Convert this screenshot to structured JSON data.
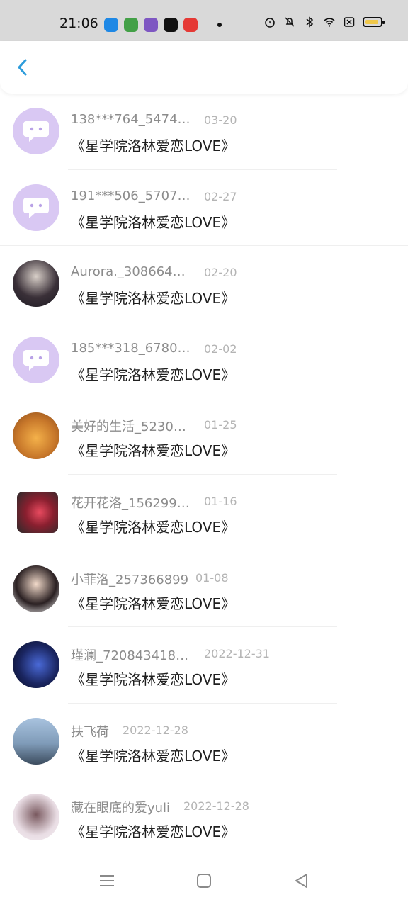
{
  "status_bar": {
    "time": "21:06",
    "app_icons": [
      {
        "name": "app-icon-1",
        "color": "#1e88e5"
      },
      {
        "name": "app-icon-2",
        "color": "#43a047"
      },
      {
        "name": "app-icon-3",
        "color": "#7e57c2"
      },
      {
        "name": "tiktok-icon",
        "color": "#111111"
      },
      {
        "name": "app-icon-5",
        "color": "#e53935"
      }
    ],
    "right_icons": [
      "alarm-icon",
      "mute-icon",
      "bluetooth-icon",
      "wifi-icon",
      "sim-icon",
      "battery-icon"
    ]
  },
  "header": {
    "back_icon": "chevron-left-icon",
    "accent": "#2d9cdb"
  },
  "messages": [
    {
      "name": "138***764_54743…",
      "date": "03-20",
      "content": "《星学院洛林爱恋LOVE》",
      "avatar": "default"
    },
    {
      "name": "191***506_570702…",
      "date": "02-27",
      "content": "《星学院洛林爱恋LOVE》",
      "avatar": "default"
    },
    {
      "name": "Aurora._30866421…",
      "date": "02-20",
      "content": "《星学院洛林爱恋LOVE》",
      "avatar": "photo"
    },
    {
      "name": "185***318_67801…",
      "date": "02-02",
      "content": "《星学院洛林爱恋LOVE》",
      "avatar": "default"
    },
    {
      "name": "美好的生活_52305…",
      "date": "01-25",
      "content": "《星学院洛林爱恋LOVE》",
      "avatar": "photo"
    },
    {
      "name": "花开花洛_156299…",
      "date": "01-16",
      "content": "《星学院洛林爱恋LOVE》",
      "avatar": "photo"
    },
    {
      "name": "小菲洛_257366899",
      "date": "01-08",
      "content": "《星学院洛林爱恋LOVE》",
      "avatar": "photo"
    },
    {
      "name": "瑾澜_7208434186…",
      "date": "2022-12-31",
      "content": "《星学院洛林爱恋LOVE》",
      "avatar": "photo"
    },
    {
      "name": "扶飞荷",
      "date": "2022-12-28",
      "content": "《星学院洛林爱恋LOVE》",
      "avatar": "photo"
    },
    {
      "name": "藏在眼底的爱yuli",
      "date": "2022-12-28",
      "content": "《星学院洛林爱恋LOVE》",
      "avatar": "photo"
    }
  ],
  "nav_bar": [
    "menu-icon",
    "home-icon",
    "back-triangle-icon"
  ]
}
